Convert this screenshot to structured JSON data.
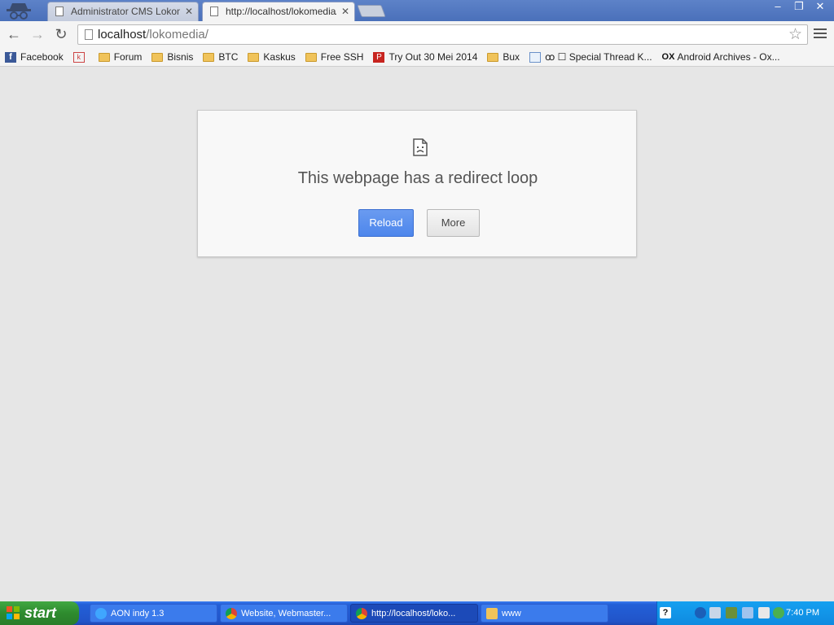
{
  "tabs": [
    {
      "title": "Administrator CMS Lokomedia",
      "active": false
    },
    {
      "title": "http://localhost/lokomedia/ f",
      "active": true
    }
  ],
  "tab_close_glyph": "✕",
  "window_buttons": {
    "minimize": "–",
    "maximize": "❐",
    "close": "✕"
  },
  "toolbar": {
    "back_glyph": "←",
    "forward_glyph": "→",
    "reload_glyph": "↻",
    "url_host": "localhost",
    "url_path": "/lokomedia/",
    "star_glyph": "☆"
  },
  "bookmarks": [
    {
      "label": "Facebook",
      "icon": "facebook-icon"
    },
    {
      "label": "",
      "icon": "kaskus-icon"
    },
    {
      "label": "Forum",
      "icon": "folder-icon"
    },
    {
      "label": "Bisnis",
      "icon": "folder-icon"
    },
    {
      "label": "BTC",
      "icon": "folder-icon"
    },
    {
      "label": "Kaskus",
      "icon": "folder-icon"
    },
    {
      "label": "Free SSH",
      "icon": "folder-icon"
    },
    {
      "label": "Try Out 30 Mei 2014",
      "icon": "red-p-icon"
    },
    {
      "label": "Bux",
      "icon": "folder-icon"
    },
    {
      "label": "ꝏ ☐ Special Thread K...",
      "icon": "forum-icon"
    },
    {
      "label": "Android Archives - Ox...",
      "icon": "ox-icon"
    }
  ],
  "error": {
    "title": "This webpage has a redirect loop",
    "reload_label": "Reload",
    "more_label": "More"
  },
  "taskbar": {
    "start_label": "start",
    "tasks": [
      {
        "label": "AON indy 1.3",
        "active": false
      },
      {
        "label": "Website, Webmaster...",
        "active": false
      },
      {
        "label": "http://localhost/loko...",
        "active": true
      },
      {
        "label": "www",
        "active": false
      }
    ],
    "clock": "7:40 PM"
  },
  "colors": {
    "accent_blue": "#4d86ec",
    "page_bg": "#e6e6e6",
    "taskbar_blue": "#2154c9",
    "start_green": "#2e8b2e"
  }
}
